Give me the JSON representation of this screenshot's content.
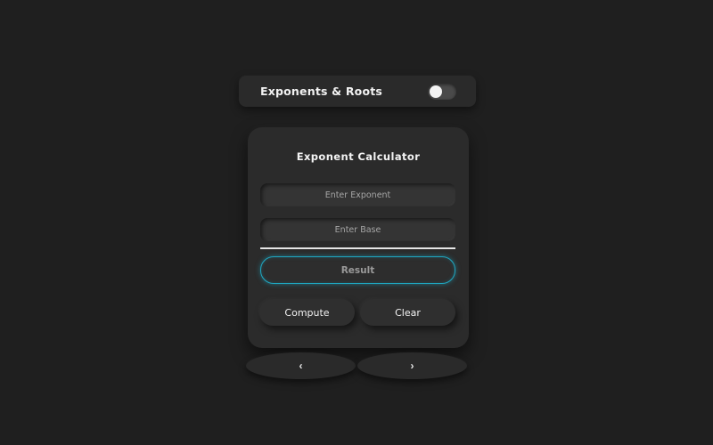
{
  "header": {
    "title": "Exponents & Roots",
    "toggle_on": false
  },
  "calculator": {
    "title": "Exponent Calculator",
    "exponent_placeholder": "Enter Exponent",
    "base_placeholder": "Enter Base",
    "result_label": "Result",
    "compute_label": "Compute",
    "clear_label": "Clear",
    "accent_color": "#1fa8c2"
  },
  "navigation": {
    "prev_label": "‹",
    "next_label": "›"
  }
}
